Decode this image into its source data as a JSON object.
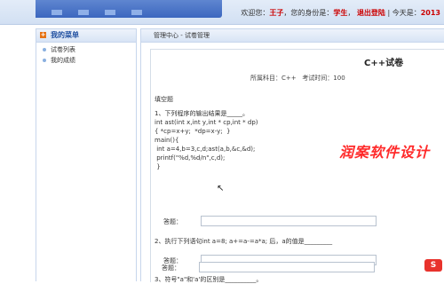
{
  "header": {
    "welcome": "欢迎您：",
    "user": "王子",
    "identity_label": "，您的身份是：",
    "role": "学生",
    "logout": "退出登陆",
    "date_label": "| 今天是：",
    "date_value": "2013"
  },
  "sidebar": {
    "title": "我的菜单",
    "items": [
      {
        "label": "试卷列表"
      },
      {
        "label": "我的成绩"
      }
    ]
  },
  "breadcrumb": "管理中心 - 试卷管理",
  "paper": {
    "title": "C++试卷",
    "subject_label": "所属科目：C++",
    "time_label": "考试时间：100",
    "section": "填空题",
    "answer_label": "答题：",
    "q1_lines": [
      "1、下列程序的输出结果是_____。",
      "int ast(int x,int y,int * cp,int * dp)",
      "{ *cp=x+y;  *dp=x-y;  }",
      "main(){",
      " int a=4,b=3,c,d;ast(a,b,&c,&d);",
      " printf(\"%d,%d/n\",c,d);",
      " }"
    ],
    "q2": "2、执行下列语句int a=8;  a+=a-=a*a; 后，a的值是_________",
    "q3": "3、符号\"a\"和'a'的区别是__________。",
    "watermark": "润案软件设计"
  },
  "icons": {
    "plus": "plus-icon",
    "bullet": "bullet-dot-icon",
    "cursor": "mouse-cursor-icon",
    "tray": "sogou-s-icon"
  },
  "colors": {
    "accent": "#cc0000",
    "menu_title": "#1f4fa0",
    "header_bg": "#3c67bf"
  }
}
